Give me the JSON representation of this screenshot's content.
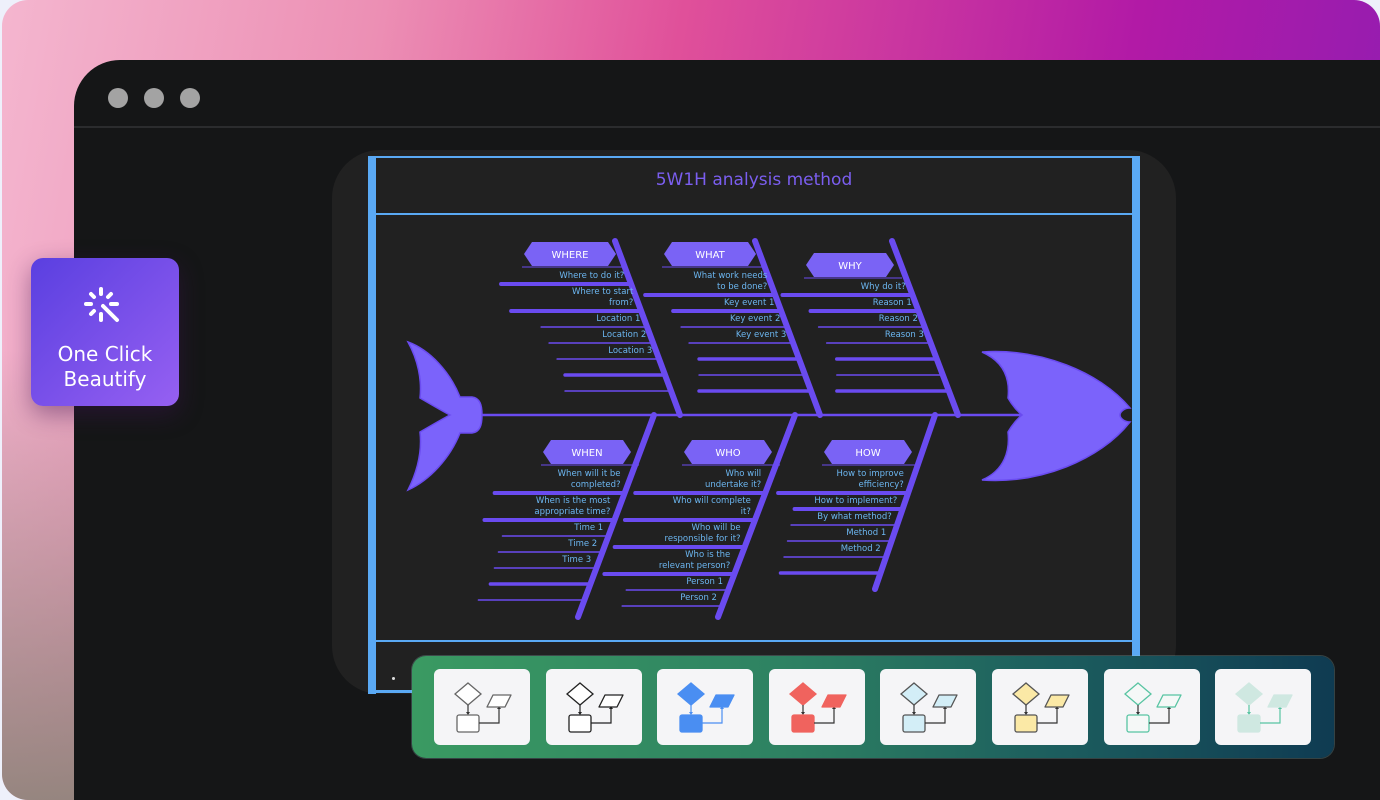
{
  "window": {
    "controls": [
      "window-dot-1",
      "window-dot-2",
      "window-dot-3"
    ]
  },
  "beautify_button": {
    "label_line1": "One Click",
    "label_line2": "Beautify",
    "icon": "sparkle-wand-icon"
  },
  "diagram": {
    "title": "5W1H analysis method",
    "type": "fishbone",
    "colors": {
      "accent": "#7b5ef0",
      "spine": "#6a4bf0",
      "frame": "#5aa9f4",
      "label_text": "#6cb6f0",
      "header_fill": "#7a63f5"
    },
    "categories": [
      {
        "name": "WHERE",
        "items": [
          "Where to do it?",
          "Where to start from?",
          "Location 1",
          "Location 2",
          "Location 3"
        ]
      },
      {
        "name": "WHAT",
        "items": [
          "What work needs to be done?",
          "Key event 1",
          "Key event 2",
          "Key event 3"
        ]
      },
      {
        "name": "WHY",
        "items": [
          "Why do it?",
          "Reason 1",
          "Reason 2",
          "Reason 3"
        ]
      },
      {
        "name": "WHEN",
        "items": [
          "When will it be completed?",
          "When is the most appropriate time?",
          "Time 1",
          "Time 2",
          "Time 3"
        ]
      },
      {
        "name": "WHO",
        "items": [
          "Who will undertake it?",
          "Who will complete it?",
          "Who will be responsible for it?",
          "Who is the relevant person?",
          "Person 1",
          "Person 2"
        ]
      },
      {
        "name": "HOW",
        "items": [
          "How to improve efficiency?",
          "How to implement?",
          "By what method?",
          "Method 1",
          "Method 2"
        ]
      }
    ]
  },
  "theme_bar": {
    "themes": [
      {
        "name": "outline-gray",
        "fill": "#ffffff",
        "stroke": "#666666",
        "connector": "#333333"
      },
      {
        "name": "outline-black",
        "fill": "#ffffff",
        "stroke": "#222222",
        "connector": "#222222"
      },
      {
        "name": "solid-blue",
        "fill": "#4a8ef2",
        "stroke": "#4a8ef2",
        "connector": "#4a8ef2"
      },
      {
        "name": "solid-red",
        "fill": "#f0635e",
        "stroke": "#f0635e",
        "connector": "#333333"
      },
      {
        "name": "light-cyan",
        "fill": "#d3eef7",
        "stroke": "#555555",
        "connector": "#333333"
      },
      {
        "name": "light-yellow",
        "fill": "#fbe9a6",
        "stroke": "#555555",
        "connector": "#333333"
      },
      {
        "name": "mint-outline",
        "fill": "#f5f8f7",
        "stroke": "#58c4a2",
        "connector": "#333333"
      },
      {
        "name": "mint-soft",
        "fill": "#cfe8e1",
        "stroke": "#cfe8e1",
        "connector": "#58c4a2"
      }
    ]
  }
}
